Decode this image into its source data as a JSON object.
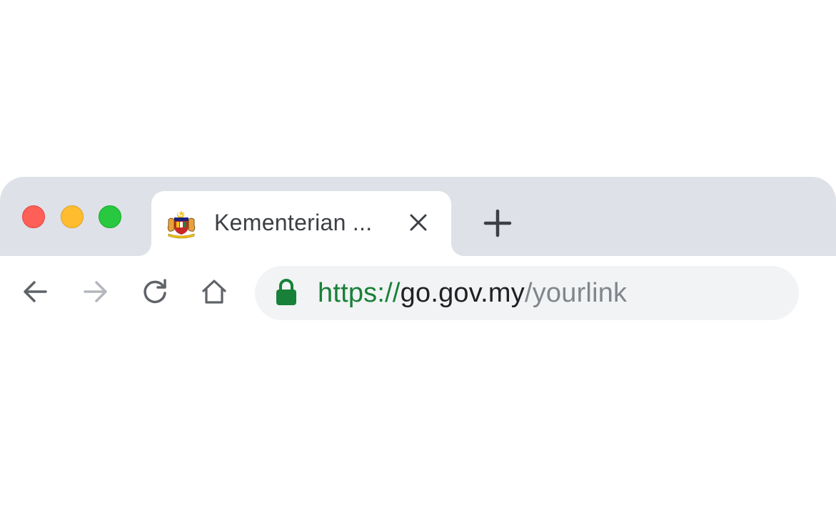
{
  "window": {
    "controls": {
      "close_color": "#fe5f57",
      "minimize_color": "#febc2e",
      "maximize_color": "#28c840"
    }
  },
  "tabs": [
    {
      "title": "Kementerian ...",
      "favicon": "malaysia-coat-of-arms-icon",
      "active": true,
      "close_icon": "close-icon"
    }
  ],
  "new_tab_icon": "plus-icon",
  "toolbar": {
    "back_icon": "arrow-left-icon",
    "forward_icon": "arrow-right-icon",
    "reload_icon": "reload-icon",
    "home_icon": "home-icon"
  },
  "address_bar": {
    "secure_icon": "lock-icon",
    "secure_color": "#188038",
    "scheme": "https://",
    "host": "go.gov.my",
    "path": "/yourlink"
  }
}
